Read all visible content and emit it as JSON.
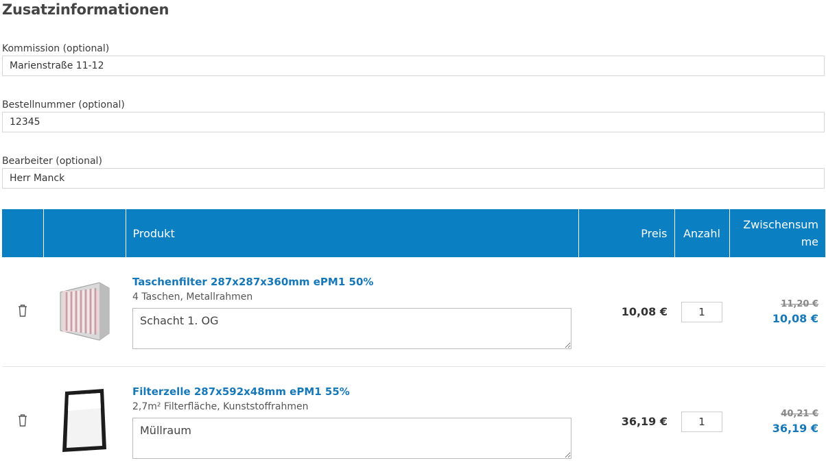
{
  "section_title": "Zusatzinformationen",
  "fields": [
    {
      "label": "Kommission (optional)",
      "value": "Marienstraße 11-12"
    },
    {
      "label": "Bestellnummer (optional)",
      "value": "12345"
    },
    {
      "label": "Bearbeiter (optional)",
      "value": "Herr Manck"
    }
  ],
  "cart": {
    "headers": {
      "product": "Produkt",
      "price": "Preis",
      "quantity": "Anzahl",
      "subtotal": "Zwischensumme"
    },
    "accent_color": "#0a7fc2",
    "items": [
      {
        "title": "Taschenfilter 287x287x360mm ePM1 50%",
        "description": "4 Taschen, Metallrahmen",
        "note": "Schacht 1. OG",
        "price": "10,08 €",
        "quantity": "1",
        "old_subtotal": "11,20 €",
        "subtotal": "10,08 €",
        "image": "pocket-filter-image"
      },
      {
        "title": "Filterzelle 287x592x48mm ePM1 55%",
        "description": "2,7m² Filterfläche, Kunststoffrahmen",
        "note": "Müllraum",
        "price": "36,19 €",
        "quantity": "1",
        "old_subtotal": "40,21 €",
        "subtotal": "36,19 €",
        "image": "panel-filter-image"
      }
    ]
  }
}
